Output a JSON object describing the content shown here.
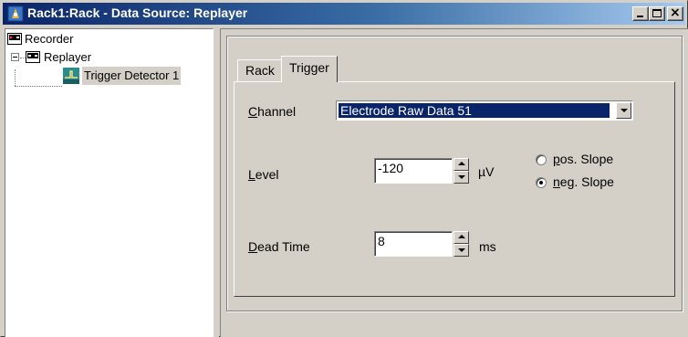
{
  "window": {
    "title": "Rack1:Rack - Data Source: Replayer",
    "controls": {
      "minimize": "_",
      "maximize": "□",
      "close": "×"
    }
  },
  "tree": {
    "items": [
      {
        "label": "Recorder",
        "icon": "recorder-icon"
      },
      {
        "label": "Replayer",
        "icon": "replayer-icon",
        "expanded": true
      },
      {
        "label": "Trigger Detector 1",
        "icon": "trigger-detector-icon",
        "selected": true
      }
    ]
  },
  "tabs": [
    {
      "label": "Rack",
      "active": false
    },
    {
      "label": "Trigger",
      "active": true
    }
  ],
  "trigger": {
    "channel": {
      "label_accel": "C",
      "label_rest": "hannel",
      "value": "Electrode Raw Data 51"
    },
    "level": {
      "label_accel": "L",
      "label_rest": "evel",
      "value": "-120",
      "unit": "µV"
    },
    "slope": {
      "pos": {
        "label_accel": "p",
        "label_rest": "os. Slope",
        "checked": false
      },
      "neg": {
        "label_accel": "n",
        "label_rest": "eg. Slope",
        "checked": true
      }
    },
    "dead_time": {
      "label_accel": "D",
      "label_rest": "ead Time",
      "value": "8",
      "unit": "ms"
    }
  },
  "colors": {
    "title_bar_start": "#0a246a",
    "title_bar_end": "#a6caf0",
    "selection": "#0a246a",
    "face": "#d4d0c8",
    "icon_teal": "#2a8c8c"
  }
}
